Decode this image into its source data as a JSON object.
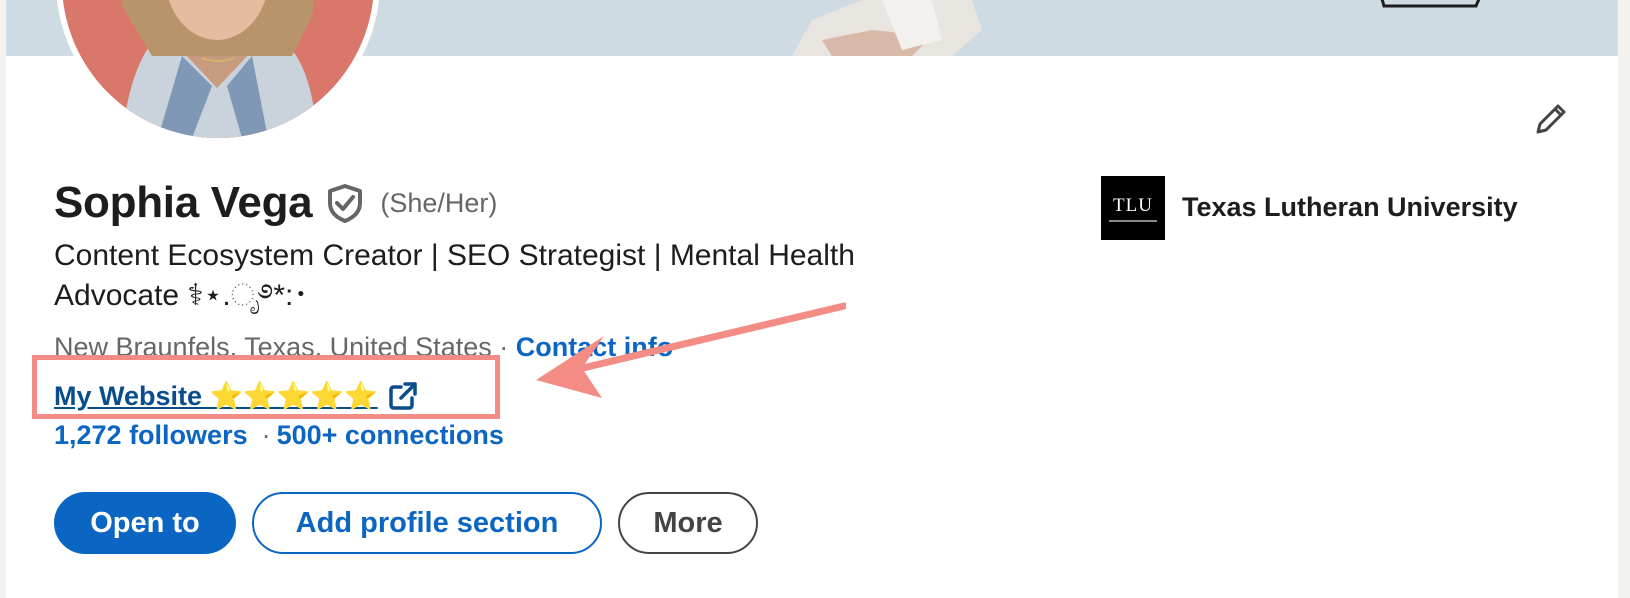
{
  "profile": {
    "name": "Sophia Vega",
    "pronouns": "(She/Her)",
    "headline": "Content Ecosystem Creator | SEO Strategist | Mental Health Advocate ⚕⋆.ೃ࿔*:･",
    "location": "New Braunfels, Texas, United States",
    "location_separator": " · ",
    "contact_label": "Contact info",
    "website_label": "My Website ⭐⭐⭐⭐⭐ ",
    "followers": "1,272 followers",
    "stats_separator": "·",
    "connections": "500+ connections"
  },
  "actions": {
    "open_to": "Open to",
    "add_section": "Add profile section",
    "more": "More"
  },
  "education": {
    "logo_text": "TLU",
    "school_name": "Texas Lutheran University"
  },
  "icons": {
    "verified": "shield-check-icon",
    "edit": "pencil-icon",
    "external": "external-link-icon"
  },
  "colors": {
    "brand_blue": "#0a66c2",
    "annotation": "#f28c84",
    "banner": "#cfdbe3"
  }
}
